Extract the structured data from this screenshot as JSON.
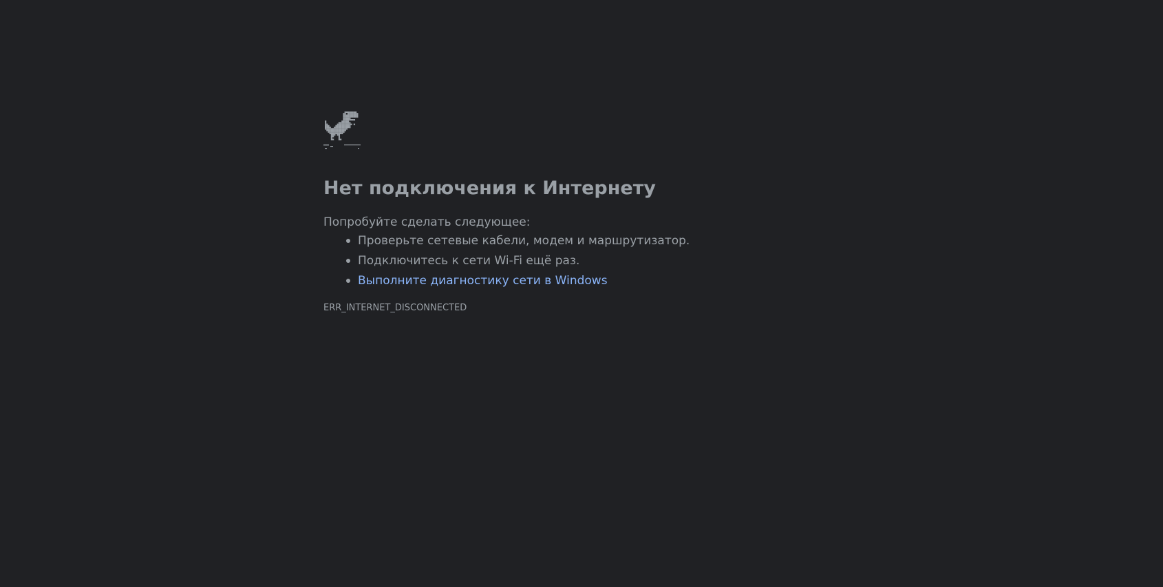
{
  "page": {
    "background_color": "#202124",
    "text_color": "#9aa0a6",
    "link_color": "#8ab4f8"
  },
  "error": {
    "icon": "offline-dinosaur-icon",
    "title": "Нет подключения к Интернету",
    "suggestions_intro": "Попробуйте сделать следующее:",
    "suggestions": [
      {
        "label": "Проверьте сетевые кабели, модем и маршрутизатор.",
        "is_link": false
      },
      {
        "label": "Подключитесь к сети Wi-Fi ещё раз.",
        "is_link": false
      },
      {
        "label": "Выполните диагностику сети в Windows",
        "is_link": true
      }
    ],
    "code": "ERR_INTERNET_DISCONNECTED"
  }
}
